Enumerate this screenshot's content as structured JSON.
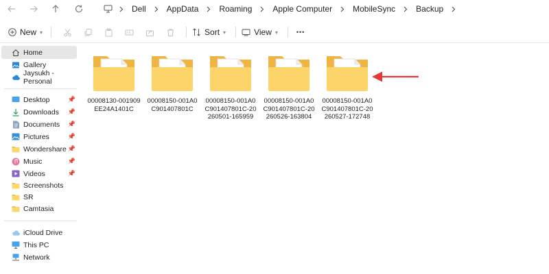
{
  "address": {
    "crumbs": [
      "Dell",
      "AppData",
      "Roaming",
      "Apple Computer",
      "MobileSync",
      "Backup"
    ]
  },
  "toolbar": {
    "new_label": "New",
    "sort_label": "Sort",
    "view_label": "View",
    "more_label": "•••"
  },
  "sidebar": {
    "top": [
      {
        "label": "Home",
        "icon": "home-icon"
      },
      {
        "label": "Gallery",
        "icon": "gallery-icon"
      },
      {
        "label": "Jaysukh - Personal",
        "icon": "onedrive-cloud-icon"
      }
    ],
    "quick": [
      {
        "label": "Desktop",
        "icon": "desktop-icon",
        "pinned": true
      },
      {
        "label": "Downloads",
        "icon": "downloads-icon",
        "pinned": true
      },
      {
        "label": "Documents",
        "icon": "documents-icon",
        "pinned": true
      },
      {
        "label": "Pictures",
        "icon": "pictures-icon",
        "pinned": true
      },
      {
        "label": "Wondershare",
        "icon": "folder-icon",
        "pinned": true
      },
      {
        "label": "Music",
        "icon": "music-icon",
        "pinned": true
      },
      {
        "label": "Videos",
        "icon": "videos-icon",
        "pinned": true
      },
      {
        "label": "Screenshots",
        "icon": "folder-icon",
        "pinned": false
      },
      {
        "label": "SR",
        "icon": "folder-icon",
        "pinned": false
      },
      {
        "label": "Camtasia",
        "icon": "folder-icon",
        "pinned": false
      }
    ],
    "bottom": [
      {
        "label": "iCloud Drive",
        "icon": "icloud-icon"
      },
      {
        "label": "This PC",
        "icon": "this-pc-icon"
      },
      {
        "label": "Network",
        "icon": "network-icon"
      }
    ]
  },
  "folders": [
    {
      "name_lines": [
        "00008130-001909",
        "EE24A1401C"
      ]
    },
    {
      "name_lines": [
        "00008150-001A0",
        "C901407801C"
      ]
    },
    {
      "name_lines": [
        "00008150-001A0",
        "C901407801C-20",
        "260501-165959"
      ]
    },
    {
      "name_lines": [
        "00008150-001A0",
        "C901407801C-20",
        "260526-163804"
      ]
    },
    {
      "name_lines": [
        "00008150-001A0",
        "C901407801C-20",
        "260527-172748"
      ]
    }
  ],
  "colors": {
    "folder_back": "#f0b540",
    "folder_front": "#fcd46a",
    "arrow": "#e53935",
    "selection": "#e6e6e6"
  }
}
